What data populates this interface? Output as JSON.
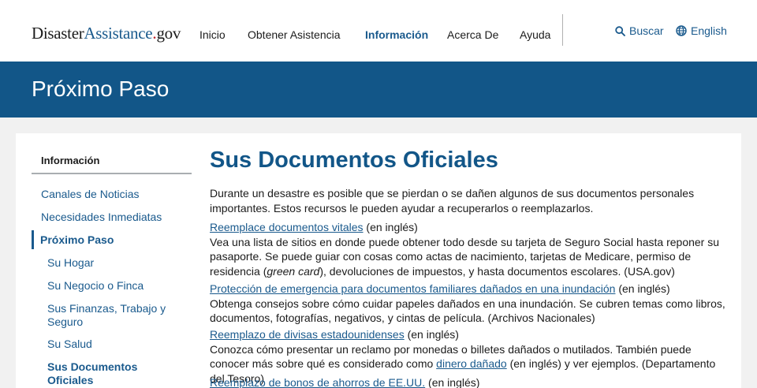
{
  "header": {
    "logo": {
      "part1": "Disaster",
      "part2": "Assistance",
      "part3": ".",
      "part4": "gov"
    },
    "nav": [
      {
        "label": "Inicio"
      },
      {
        "label": "Obtener Asistencia"
      },
      {
        "label": "Información"
      },
      {
        "label": "Acerca De"
      },
      {
        "label": "Ayuda"
      }
    ],
    "search_label": "Buscar",
    "language_label": "English"
  },
  "banner": {
    "title": "Próximo Paso"
  },
  "sidebar": {
    "title": "Información",
    "items": [
      {
        "label": "Canales de Noticias"
      },
      {
        "label": "Necesidades Inmediatas"
      },
      {
        "label": "Próximo Paso"
      },
      {
        "label": "Su Hogar"
      },
      {
        "label": "Su Negocio o Finca"
      },
      {
        "label": "Sus Finanzas, Trabajo y Seguro"
      },
      {
        "label": "Su Salud"
      },
      {
        "label": "Sus Documentos Oficiales"
      }
    ]
  },
  "main": {
    "title": "Sus Documentos Oficiales",
    "intro": "Durante un desastre es posible que se pierdan o se dañen algunos de sus documentos personales importantes. Estos recursos le pueden ayudar a recuperarlos o reemplazarlos.",
    "resources": [
      {
        "link": "Reemplace documentos vitales",
        "lang": " (en inglés)",
        "desc_a": "Vea una lista de sitios en donde puede obtener todo desde su tarjeta de Seguro Social hasta reponer su pasaporte. Se puede guiar con cosas como actas de nacimiento, tarjetas de Medicare, permiso de residencia (",
        "desc_em": "green card",
        "desc_b": "), devoluciones de impuestos, y hasta documentos escolares. (USA.gov)"
      },
      {
        "link": "Protección de emergencia para documentos familiares dañados en una inundación",
        "lang": " (en inglés)",
        "desc": "Obtenga consejos sobre cómo cuidar papeles dañados en una inundación. Se cubren temas como libros, documentos, fotografías, negativos, y cintas de película. (Archivos Nacionales)"
      },
      {
        "link": "Reemplazo de divisas estadounidenses",
        "lang": " (en inglés)",
        "desc_a": "Conozca cómo presentar un reclamo por monedas o billetes dañados o mutilados. También puede conocer más sobre qué es considerado como ",
        "inline_link": "dinero dañado",
        "desc_b": " (en inglés) y ver ejemplos. (Departamento del Tesoro)"
      },
      {
        "link": "Reemplazo de bonos de ahorros de EE.UU.",
        "lang": " (en inglés)"
      }
    ]
  },
  "colors": {
    "brand_blue": "#125688",
    "link_blue": "#1a5a8d",
    "logo_red": "#c0262d",
    "page_bg": "#f1f1f1"
  },
  "icons": [
    "search-icon",
    "globe-icon"
  ]
}
